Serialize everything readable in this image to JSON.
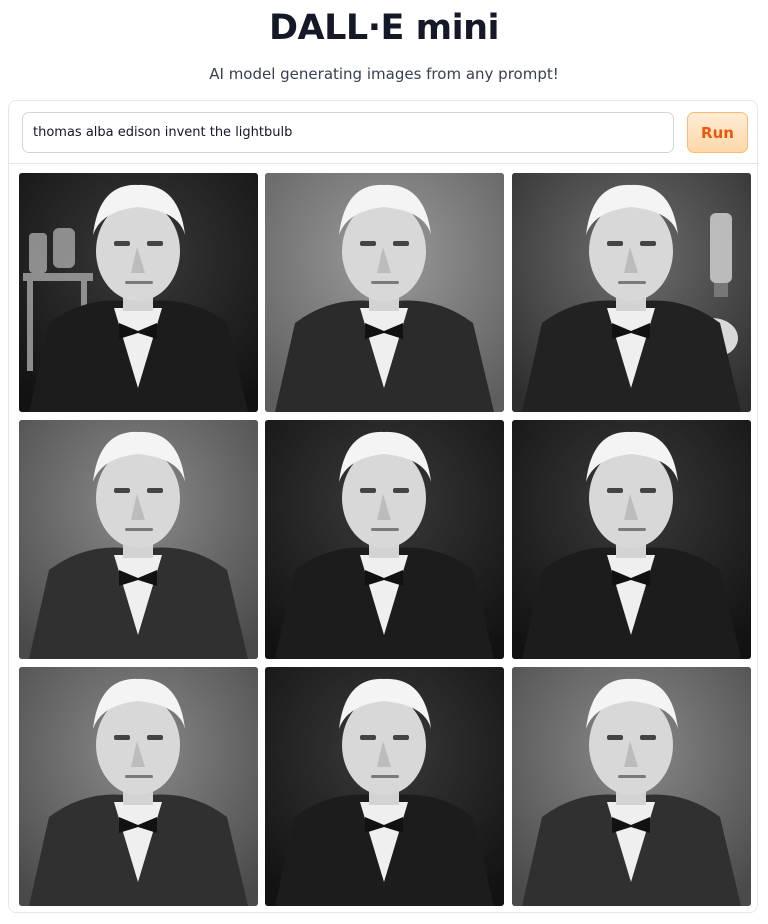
{
  "header": {
    "title": "DALL·E mini",
    "subtitle": "AI model generating images from any prompt!"
  },
  "prompt": {
    "value": "thomas alba edison invent the lightbulb",
    "run_label": "Run"
  },
  "gallery": {
    "images": [
      {
        "name": "generated-image-1",
        "tone": "dark",
        "prop": "apparatus-left"
      },
      {
        "name": "generated-image-2",
        "tone": "light",
        "prop": "none"
      },
      {
        "name": "generated-image-3",
        "tone": "mottled",
        "prop": "lightbulb-right"
      },
      {
        "name": "generated-image-4",
        "tone": "mid",
        "prop": "none"
      },
      {
        "name": "generated-image-5",
        "tone": "dark",
        "prop": "none"
      },
      {
        "name": "generated-image-6",
        "tone": "dark",
        "prop": "none"
      },
      {
        "name": "generated-image-7",
        "tone": "mid",
        "prop": "none"
      },
      {
        "name": "generated-image-8",
        "tone": "dark",
        "prop": "none"
      },
      {
        "name": "generated-image-9",
        "tone": "mid",
        "prop": "none"
      }
    ]
  },
  "colors": {
    "accent": "#ea580c",
    "button_bg": "#fed7aa",
    "border": "#e5e7eb"
  }
}
